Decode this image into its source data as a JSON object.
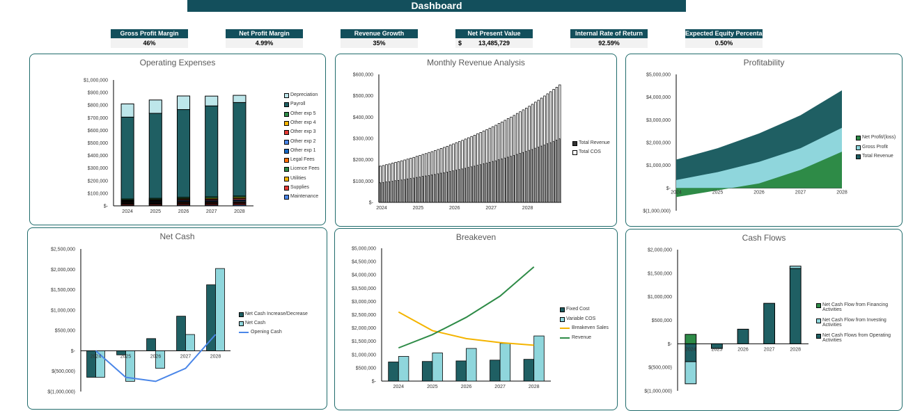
{
  "header": {
    "title": "Dashboard"
  },
  "kpis": [
    {
      "label": "Gross Profit Margin",
      "value": "46%"
    },
    {
      "label": "Net Profit Margin",
      "value": "4.99%"
    },
    {
      "label": "Revenue Growth",
      "value": "35%"
    },
    {
      "label": "Net Present Value",
      "currency": "$",
      "value": "13,485,729"
    },
    {
      "label": "Internal Rate of Return",
      "value": "92.59%"
    },
    {
      "label": "Expected Equity Percentage",
      "value": "0.50%"
    }
  ],
  "chart_data": [
    {
      "id": "opex",
      "title": "Operating Expenses",
      "type": "bar",
      "stacked": true,
      "categories": [
        "2024",
        "2025",
        "2026",
        "2027",
        "2028"
      ],
      "ylim": [
        0,
        1000000
      ],
      "ystep": 100000,
      "grid": false,
      "legend": "right",
      "series": [
        {
          "name": "Maintenance",
          "kind": "bar",
          "color": "#4a86e8",
          "values": [
            6000,
            6000,
            7000,
            7000,
            8000
          ]
        },
        {
          "name": "Supplies",
          "kind": "bar",
          "color": "#e53935",
          "values": [
            8000,
            8000,
            9000,
            9000,
            10000
          ]
        },
        {
          "name": "Utilities",
          "kind": "bar",
          "color": "#f4b400",
          "values": [
            4000,
            4000,
            5000,
            5000,
            5000
          ]
        },
        {
          "name": "Licence Fees",
          "kind": "bar",
          "color": "#2e8b47",
          "values": [
            3000,
            3000,
            3000,
            3000,
            3000
          ]
        },
        {
          "name": "Legal Fees",
          "kind": "bar",
          "color": "#ff6d00",
          "values": [
            6000,
            6000,
            7000,
            7000,
            7000
          ]
        },
        {
          "name": "Other exp 1",
          "kind": "bar",
          "color": "#1565c0",
          "values": [
            5000,
            6000,
            7000,
            7000,
            8000
          ]
        },
        {
          "name": "Other exp 2",
          "kind": "bar",
          "color": "#4a86e8",
          "values": [
            5000,
            6000,
            7000,
            7000,
            8000
          ]
        },
        {
          "name": "Other exp 3",
          "kind": "bar",
          "color": "#e53935",
          "values": [
            5000,
            6000,
            7000,
            8000,
            9000
          ]
        },
        {
          "name": "Other exp 4",
          "kind": "bar",
          "color": "#f4b400",
          "values": [
            5000,
            6000,
            7000,
            8000,
            9000
          ]
        },
        {
          "name": "Other exp 5",
          "kind": "bar",
          "color": "#2e8b47",
          "values": [
            8000,
            9000,
            9000,
            11000,
            11000
          ]
        },
        {
          "name": "Payroll",
          "kind": "bar",
          "color": "#1f5f63",
          "values": [
            650000,
            675000,
            697000,
            722000,
            743000
          ]
        },
        {
          "name": "Depreciation",
          "kind": "bar",
          "color": "#bde6ea",
          "values": [
            105000,
            106000,
            108000,
            78000,
            57000
          ]
        }
      ]
    },
    {
      "id": "monthly",
      "title": "Monthly Revenue Analysis",
      "type": "bar",
      "stacked": false,
      "overlap": true,
      "categories": [
        "2024",
        "2025",
        "2026",
        "2027",
        "2028"
      ],
      "ylim": [
        0,
        600000
      ],
      "ystep": 100000,
      "grid": false,
      "legend": "right",
      "series": [
        {
          "name": "Total COS",
          "kind": "bar",
          "color": "#ffffff",
          "values": [
            92000,
            93000,
            96000,
            97000,
            99000,
            102000,
            103000,
            105000,
            107000,
            110000,
            112000,
            114000,
            117000,
            119000,
            122000,
            124000,
            126000,
            129000,
            131000,
            134000,
            137000,
            139000,
            142000,
            145000,
            148000,
            151000,
            154000,
            157000,
            160000,
            164000,
            167000,
            170000,
            174000,
            177000,
            181000,
            184000,
            188000,
            192000,
            195000,
            200000,
            204000,
            208000,
            212000,
            216000,
            220000,
            225000,
            230000,
            234000,
            239000,
            244000,
            248000,
            254000,
            259000,
            264000,
            269000,
            275000,
            280000,
            286000,
            292000,
            298000
          ]
        },
        {
          "name": "Total Revenue",
          "kind": "bar",
          "color": "#222222",
          "values": [
            170000,
            173000,
            177000,
            180000,
            184000,
            188000,
            191000,
            195000,
            199000,
            203000,
            207000,
            211000,
            216000,
            220000,
            225000,
            229000,
            234000,
            238000,
            243000,
            248000,
            253000,
            258000,
            263000,
            269000,
            274000,
            280000,
            285000,
            291000,
            297000,
            303000,
            309000,
            315000,
            322000,
            328000,
            335000,
            341000,
            348000,
            355000,
            362000,
            370000,
            377000,
            385000,
            393000,
            400000,
            408000,
            417000,
            425000,
            434000,
            442000,
            451000,
            460000,
            470000,
            479000,
            489000,
            499000,
            509000,
            519000,
            530000,
            540000,
            551000
          ]
        }
      ]
    },
    {
      "id": "profit",
      "title": "Profitability",
      "type": "area",
      "stacked": false,
      "categories": [
        "2024",
        "2025",
        "2026",
        "2027",
        "2028"
      ],
      "ylim": [
        -1000000,
        5000000
      ],
      "ystep": 1000000,
      "grid": false,
      "legend": "right",
      "series": [
        {
          "name": "Total Revenue",
          "kind": "area",
          "color": "#1f5f63",
          "values": [
            1250000,
            1750000,
            2400000,
            3200000,
            4300000
          ]
        },
        {
          "name": "Gross Profit",
          "kind": "area",
          "color": "#8fd6dc",
          "values": [
            350000,
            700000,
            1150000,
            1750000,
            2650000
          ]
        },
        {
          "name": "Net Profit/(loss)",
          "kind": "area",
          "color": "#2e8b47",
          "values": [
            -400000,
            -100000,
            200000,
            800000,
            1600000
          ]
        }
      ]
    },
    {
      "id": "netcash",
      "title": "Net Cash",
      "type": "bar",
      "stacked": false,
      "categories": [
        "2024",
        "2025",
        "2026",
        "2027",
        "2028"
      ],
      "ylim": [
        -1000000,
        2500000
      ],
      "ystep": 500000,
      "grid": false,
      "legend": "right",
      "xlabels_at_zero": true,
      "series": [
        {
          "name": "Net Cash Increase/Decrease",
          "kind": "bar",
          "color": "#1f5f63",
          "values": [
            -650000,
            -100000,
            300000,
            850000,
            1620000
          ]
        },
        {
          "name": "Net Cash",
          "kind": "bar",
          "color": "#8fd6dc",
          "values": [
            -650000,
            -750000,
            -430000,
            400000,
            2020000
          ]
        },
        {
          "name": "Opening Cash",
          "kind": "line",
          "color": "#4a86e8",
          "values": [
            0,
            -650000,
            -750000,
            -430000,
            400000
          ]
        }
      ]
    },
    {
      "id": "breakeven",
      "title": "Breakeven",
      "type": "bar",
      "stacked": false,
      "categories": [
        "2024",
        "2025",
        "2026",
        "2027",
        "2028"
      ],
      "ylim": [
        0,
        5000000
      ],
      "ystep": 500000,
      "grid": false,
      "legend": "right",
      "series": [
        {
          "name": "Fixed Cost",
          "kind": "bar",
          "color": "#1f5f63",
          "values": [
            720000,
            740000,
            760000,
            790000,
            820000
          ]
        },
        {
          "name": "Variable COS",
          "kind": "bar",
          "color": "#8fd6dc",
          "values": [
            930000,
            1060000,
            1230000,
            1420000,
            1700000
          ]
        },
        {
          "name": "Breakeven Sales",
          "kind": "line",
          "color": "#f4b400",
          "values": [
            2600000,
            1900000,
            1600000,
            1450000,
            1350000
          ]
        },
        {
          "name": "Revenue",
          "kind": "line",
          "color": "#2e8b47",
          "values": [
            1250000,
            1750000,
            2400000,
            3200000,
            4300000
          ]
        }
      ]
    },
    {
      "id": "cashflows",
      "title": "Cash Flows",
      "type": "bar",
      "stacked": true,
      "categories": [
        "2024",
        "2025",
        "2026",
        "2027",
        "2028"
      ],
      "ylim": [
        -1000000,
        2000000
      ],
      "ystep": 500000,
      "grid": false,
      "legend": "right",
      "xlabels_at_zero": true,
      "series": [
        {
          "name": "Net Cash Flows from Operating Activities",
          "kind": "bar",
          "color": "#1f5f63",
          "values": [
            -380000,
            -100000,
            310000,
            860000,
            1600000
          ]
        },
        {
          "name": "Net Cash Flow from Investing Activities",
          "kind": "bar",
          "color": "#8fd6dc",
          "values": [
            -470000,
            0,
            0,
            0,
            50000
          ]
        },
        {
          "name": "Net Cash Flow from Financing Activities",
          "kind": "bar",
          "color": "#2e8b47",
          "values": [
            200000,
            0,
            0,
            0,
            0
          ]
        }
      ]
    }
  ]
}
